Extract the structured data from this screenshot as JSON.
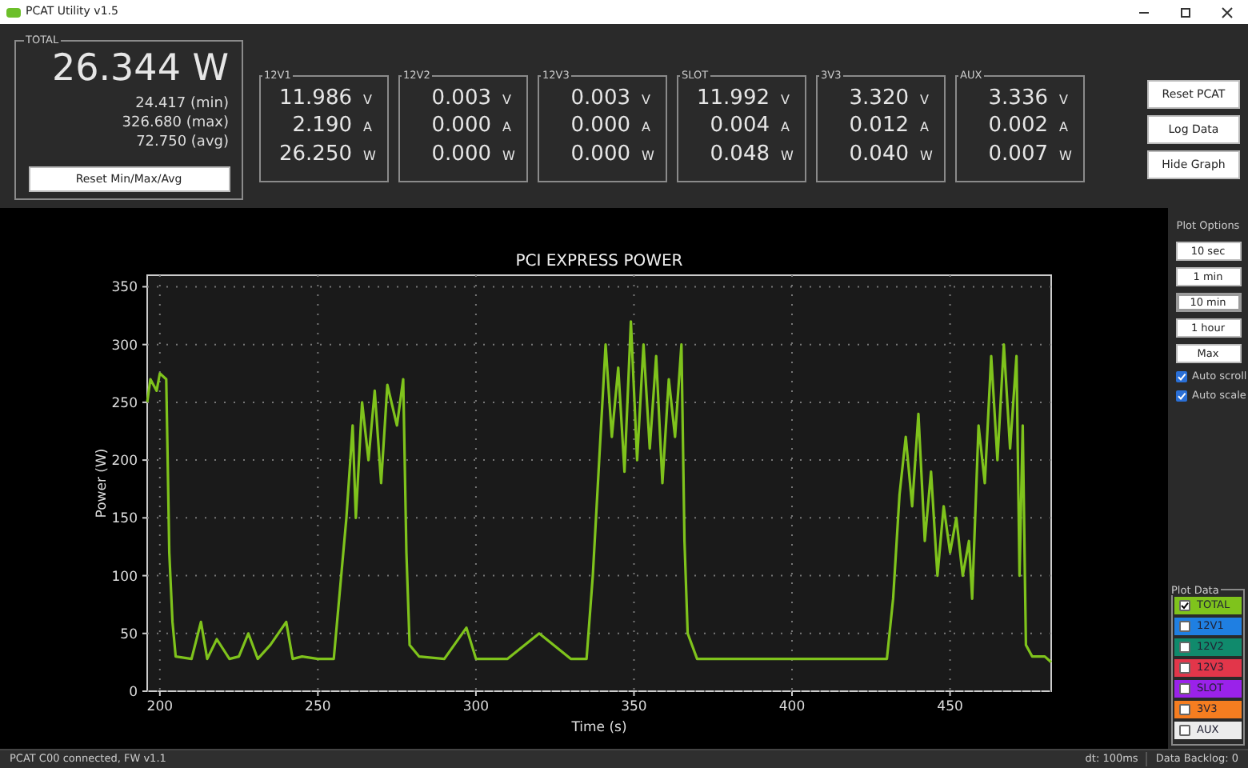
{
  "window": {
    "title": "PCAT Utility v1.5"
  },
  "total": {
    "label": "TOTAL",
    "value": "26.344 W",
    "min": "24.417 (min)",
    "max": "326.680 (max)",
    "avg": "72.750 (avg)",
    "reset_button": "Reset Min/Max/Avg"
  },
  "channels": [
    {
      "name": "12V1",
      "rows": [
        {
          "value": "11.986",
          "unit": "V"
        },
        {
          "value": "2.190",
          "unit": "A"
        },
        {
          "value": "26.250",
          "unit": "W"
        }
      ]
    },
    {
      "name": "12V2",
      "rows": [
        {
          "value": "0.003",
          "unit": "V"
        },
        {
          "value": "0.000",
          "unit": "A"
        },
        {
          "value": "0.000",
          "unit": "W"
        }
      ]
    },
    {
      "name": "12V3",
      "rows": [
        {
          "value": "0.003",
          "unit": "V"
        },
        {
          "value": "0.000",
          "unit": "A"
        },
        {
          "value": "0.000",
          "unit": "W"
        }
      ]
    },
    {
      "name": "SLOT",
      "rows": [
        {
          "value": "11.992",
          "unit": "V"
        },
        {
          "value": "0.004",
          "unit": "A"
        },
        {
          "value": "0.048",
          "unit": "W"
        }
      ]
    },
    {
      "name": "3V3",
      "rows": [
        {
          "value": "3.320",
          "unit": "V"
        },
        {
          "value": "0.012",
          "unit": "A"
        },
        {
          "value": "0.040",
          "unit": "W"
        }
      ]
    },
    {
      "name": "AUX",
      "rows": [
        {
          "value": "3.336",
          "unit": "V"
        },
        {
          "value": "0.002",
          "unit": "A"
        },
        {
          "value": "0.007",
          "unit": "W"
        }
      ]
    }
  ],
  "buttons": [
    "Reset PCAT",
    "Log Data",
    "Hide Graph"
  ],
  "plot": {
    "chart_data": {
      "type": "line",
      "title": "PCI EXPRESS POWER",
      "xlabel": "Time (s)",
      "ylabel": "Power (W)",
      "xlim": [
        196,
        482
      ],
      "ylim": [
        0,
        360
      ],
      "xticks": [
        200,
        250,
        300,
        350,
        400,
        450
      ],
      "yticks": [
        0,
        50,
        100,
        150,
        200,
        250,
        300,
        350
      ],
      "x": [
        196,
        197,
        199,
        200,
        202,
        203,
        204,
        205,
        210,
        213,
        215,
        218,
        222,
        225,
        228,
        231,
        235,
        240,
        242,
        245,
        250,
        255,
        259,
        261,
        262,
        264,
        266,
        268,
        270,
        272,
        275,
        277,
        278,
        279,
        282,
        290,
        297,
        300,
        310,
        320,
        330,
        335,
        337,
        339,
        341,
        343,
        345,
        347,
        349,
        351,
        353,
        355,
        357,
        359,
        361,
        363,
        365,
        366,
        367,
        370,
        380,
        390,
        400,
        410,
        420,
        430,
        432,
        434,
        436,
        438,
        440,
        442,
        444,
        446,
        448,
        450,
        452,
        454,
        456,
        457,
        459,
        461,
        463,
        465,
        467,
        469,
        471,
        472,
        473,
        474,
        476,
        480,
        482
      ],
      "grid": true,
      "series": [
        {
          "color": "#7fc31c",
          "values": [
            250,
            270,
            260,
            275,
            270,
            120,
            60,
            30,
            28,
            60,
            28,
            45,
            28,
            30,
            50,
            28,
            40,
            60,
            28,
            30,
            28,
            28,
            150,
            230,
            150,
            250,
            200,
            260,
            180,
            265,
            230,
            270,
            120,
            40,
            30,
            28,
            55,
            28,
            28,
            50,
            28,
            28,
            100,
            200,
            300,
            220,
            280,
            190,
            320,
            200,
            300,
            210,
            290,
            180,
            270,
            220,
            300,
            130,
            50,
            28,
            28,
            28,
            28,
            28,
            28,
            28,
            80,
            170,
            220,
            160,
            240,
            130,
            190,
            100,
            160,
            120,
            150,
            100,
            130,
            80,
            230,
            180,
            290,
            200,
            300,
            210,
            290,
            100,
            230,
            40,
            30,
            30,
            25
          ]
        }
      ]
    }
  },
  "plot_options": {
    "label": "Plot Options",
    "ranges": [
      {
        "label": "10 sec",
        "selected": false
      },
      {
        "label": "1 min",
        "selected": false
      },
      {
        "label": "10 min",
        "selected": true
      },
      {
        "label": "1 hour",
        "selected": false
      },
      {
        "label": "Max",
        "selected": false
      }
    ],
    "checks": [
      {
        "label": "Auto scroll",
        "checked": true
      },
      {
        "label": "Auto scale",
        "checked": true
      }
    ]
  },
  "plot_data": {
    "label": "Plot Data",
    "items": [
      {
        "label": "TOTAL",
        "checked": true,
        "color": "#7fc31c"
      },
      {
        "label": "12V1",
        "checked": false,
        "color": "#1f7fe2"
      },
      {
        "label": "12V2",
        "checked": false,
        "color": "#108a6c"
      },
      {
        "label": "12V3",
        "checked": false,
        "color": "#e2364a"
      },
      {
        "label": "SLOT",
        "checked": false,
        "color": "#9a22ea"
      },
      {
        "label": "3V3",
        "checked": false,
        "color": "#f57d20"
      },
      {
        "label": "AUX",
        "checked": false,
        "color": "#ececec"
      }
    ]
  },
  "status_bar": {
    "connection": "PCAT C00 connected, FW v1.1",
    "dt": "dt: 100ms",
    "backlog": "Data Backlog: 0"
  }
}
